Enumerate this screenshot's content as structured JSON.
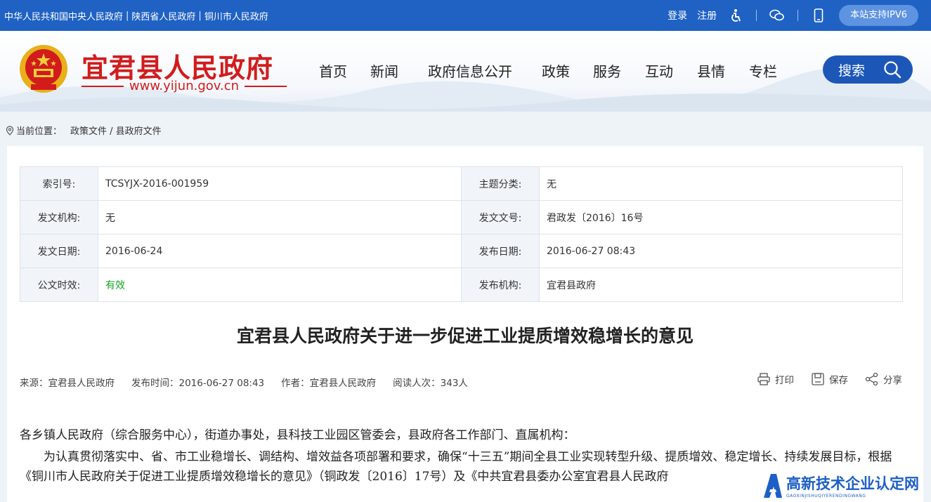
{
  "topbar": {
    "links": [
      "中华人民共和国中央人民政府",
      "陕西省人民政府",
      "铜川市人民政府"
    ],
    "separator": "|",
    "login": "登录",
    "register": "注册",
    "ipv6": "本站支持IPV6",
    "icons": [
      "accessibility-icon",
      "wechat-icon",
      "mobile-icon"
    ]
  },
  "header": {
    "site_name": "宜君县人民政府",
    "site_url": "www.yijun.gov.cn",
    "nav": [
      "首页",
      "新闻",
      "政府信息公开",
      "政策",
      "服务",
      "互动",
      "县情",
      "专栏"
    ],
    "search_label": "搜索"
  },
  "breadcrumb": {
    "label": "当前位置：",
    "path": "政策文件 / 县政府文件"
  },
  "meta": {
    "rows": [
      [
        {
          "label": "索引号:",
          "value": "TCSYJX-2016-001959"
        },
        {
          "label": "主题分类:",
          "value": "无"
        }
      ],
      [
        {
          "label": "发文机构:",
          "value": "无"
        },
        {
          "label": "发文文号:",
          "value": "君政发〔2016〕16号"
        }
      ],
      [
        {
          "label": "发文日期:",
          "value": "2016-06-24"
        },
        {
          "label": "发布日期:",
          "value": "2016-06-27 08:43"
        }
      ],
      [
        {
          "label": "公文时效:",
          "value": "有效"
        },
        {
          "label": "发布机构:",
          "value": "宜君县政府"
        }
      ]
    ]
  },
  "article": {
    "title": "宜君县人民政府关于进一步促进工业提质增效稳增长的意见",
    "source": "来源：宜君县人民政府",
    "publish_time": "发布时间：2016-06-27 08:43",
    "author": "作者：宜君县人民政府",
    "views": "阅读人次：343人",
    "print": "打印",
    "save": "保存",
    "share": "分享",
    "paragraph1": "各乡镇人民政府（综合服务中心），街道办事处，县科技工业园区管委会，县政府各工作部门、直属机构：",
    "paragraph2": "为认真贯彻落实中、省、市工业稳增长、调结构、增效益各项部署和要求，确保“十三五”期间全县工业实现转型升级、提质增效、稳定增长、持续发展目标，根据《铜川市人民政府关于促进工业提质增效稳增长的意见》（铜政发〔2016〕17号）及《中共宜君县委办公室宜君县人民政府"
  },
  "watermark": {
    "text": "高新技术企业认定网",
    "pinyin": "GAOXINJISHUQIYERENDINGWANG"
  },
  "colors": {
    "topbar": "#1f62c4",
    "brand_red": "#d21c1c",
    "search": "#1c57b8",
    "valid_green": "#13a51e"
  }
}
